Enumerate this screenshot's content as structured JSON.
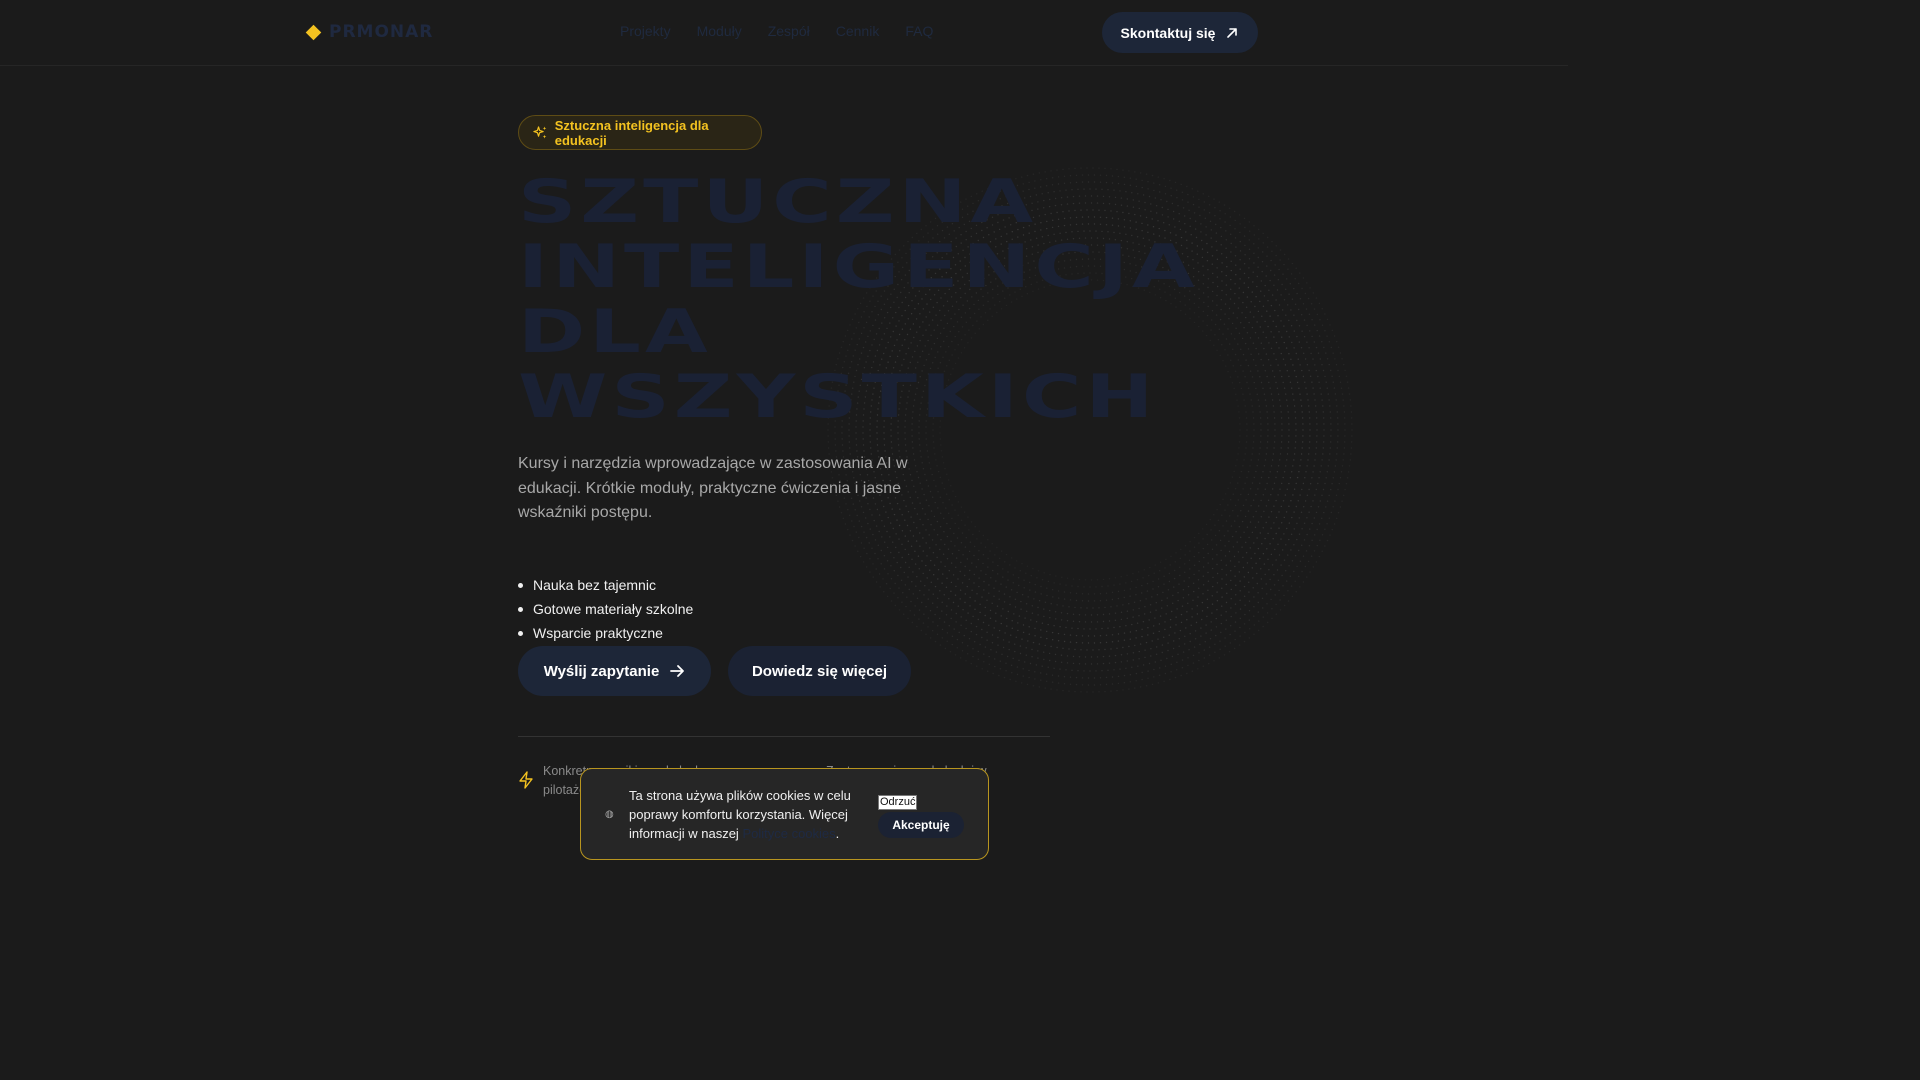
{
  "header": {
    "logo_text": "PRMONAR",
    "nav": [
      "Projekty",
      "Moduły",
      "Zespół",
      "Cennik",
      "FAQ"
    ],
    "contact_label": "Skontaktuj się"
  },
  "hero": {
    "badge": "Sztuczna inteligencja dla edukacji",
    "title_lines": [
      "SZTUCZNA",
      "INTELIGENCJA",
      "DLA",
      "WSZYSTKICH"
    ],
    "description": "Kursy i narzędzia wprowadzające w zastosowania AI w edukacji. Krótkie moduły, praktyczne ćwiczenia i jasne wskaźniki postępu.",
    "features": [
      "Nauka bez tajemnic",
      "Gotowe materiały szkolne",
      "Wsparcie praktyczne"
    ],
    "primary_button": "Wyślij zapytanie",
    "secondary_button": "Dowiedz się więcej"
  },
  "stats": {
    "left_text": "Konkretne wyniki w szkołach pilotażowych",
    "right_text": "Zastosowanie w szkołach i w"
  },
  "cookie": {
    "text_before_link": "Ta strona używa plików cookies w celu poprawy komfortu korzystania. Więcej informacji w naszej ",
    "link_text": "Polityce cookies",
    "text_after_link": ".",
    "reject_label": "Odrzuć",
    "accept_label": "Akceptuję"
  },
  "colors": {
    "background": "#1b1b1b",
    "accent": "#f3c220",
    "navy": "#1d2638"
  },
  "icons": {
    "logo": "diamond-icon",
    "contact": "arrow-up-right-icon",
    "badge": "sparkles-icon",
    "primary": "arrow-right-icon",
    "stat": "lightning-icon",
    "cookie": "cookie-icon"
  }
}
